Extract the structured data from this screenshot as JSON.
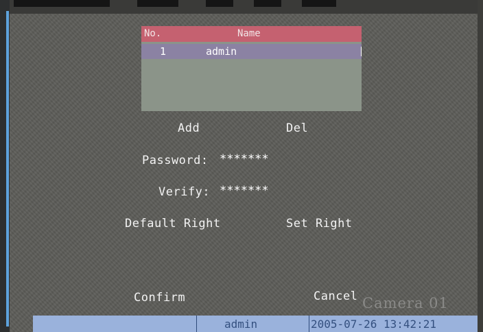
{
  "user_list": {
    "header": {
      "no": "No.",
      "name": "Name"
    },
    "rows": [
      {
        "no": "1",
        "name": "admin"
      }
    ]
  },
  "actions": {
    "add": "Add",
    "del": "Del"
  },
  "password": {
    "label": "Password:",
    "value": "*******"
  },
  "verify": {
    "label": "Verify:",
    "value": "*******"
  },
  "rights": {
    "default": "Default Right",
    "set": "Set Right"
  },
  "dialog": {
    "confirm": "Confirm",
    "cancel": "Cancel"
  },
  "overlay": {
    "camera": "Camera 01"
  },
  "status_bar": {
    "user": "admin",
    "datetime": "2005-07-26 13:42:21"
  },
  "colors": {
    "background": "#5c5c58",
    "header": "#c56170",
    "selected_row": "#8b82a3",
    "status_bar": "#9ab2dc"
  }
}
